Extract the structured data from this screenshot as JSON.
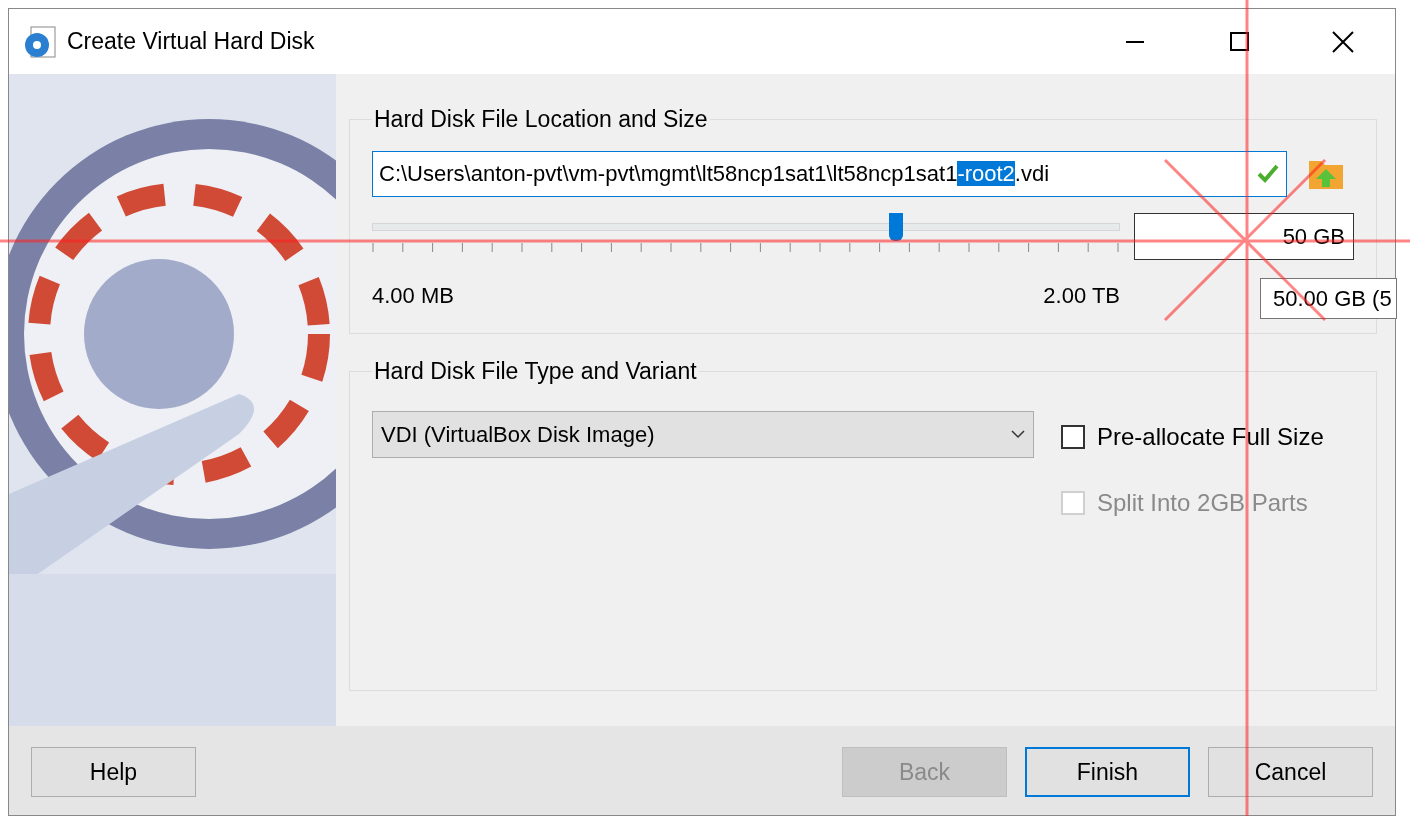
{
  "window": {
    "title": "Create Virtual Hard Disk"
  },
  "location": {
    "title": "Hard Disk File Location and Size",
    "path": {
      "before": "C:\\Users\\anton-pvt\\vm-pvt\\mgmt\\lt58ncp1sat1\\lt58ncp1sat1",
      "selected": "-root2",
      "after": ".vdi",
      "valid": true
    },
    "size": {
      "level": 0.7,
      "min_label": "4.00 MB",
      "max_label": "2.00 TB",
      "value": "50 GB",
      "tooltip": "50.00 GB (5"
    }
  },
  "type": {
    "title": "Hard Disk File Type and Variant",
    "format": "VDI (VirtualBox Disk Image)",
    "options": [
      {
        "label": "Pre-allocate Full Size",
        "checked": false,
        "disabled": false
      },
      {
        "label": "Split Into 2GB Parts",
        "checked": false,
        "disabled": true
      }
    ]
  },
  "buttons": [
    {
      "label": "Help",
      "disabled": false,
      "default": false
    },
    {
      "label": "Back",
      "disabled": true,
      "default": false
    },
    {
      "label": "Finish",
      "disabled": false,
      "default": true
    },
    {
      "label": "Cancel",
      "disabled": false,
      "default": false
    }
  ]
}
